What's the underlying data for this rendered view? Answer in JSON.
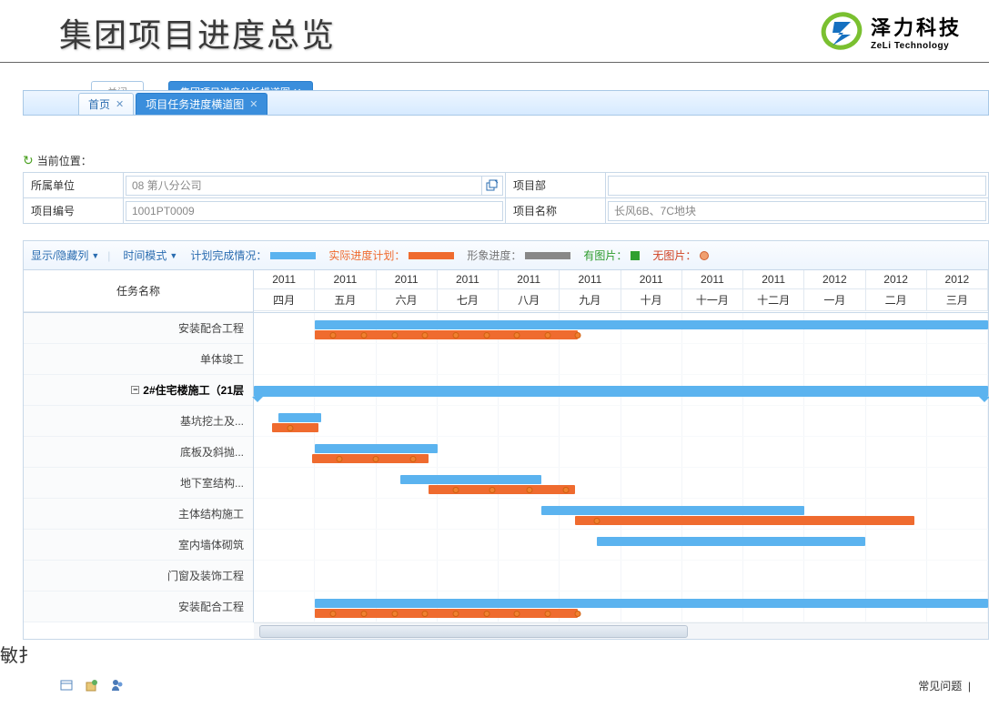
{
  "header": {
    "title": "集团项目进度总览",
    "logo_cn": "泽力科技",
    "logo_en": "ZeLi Technology"
  },
  "bg_tabs": {
    "t1": "关闭",
    "t2": "集团项目进度分析横道图"
  },
  "tabs": [
    {
      "label": "首页",
      "active": false
    },
    {
      "label": "项目任务进度横道图",
      "active": true
    }
  ],
  "breadcrumb": {
    "label": "当前位置："
  },
  "form": {
    "unit_label": "所属单位",
    "unit_value": "08 第八分公司",
    "dept_label": "项目部",
    "dept_value": "",
    "code_label": "项目编号",
    "code_value": "1001PT0009",
    "name_label": "项目名称",
    "name_value": "长风6B、7C地块"
  },
  "toolbar": {
    "show_hide": "显示/隐藏列",
    "time_mode": "时间模式",
    "legend_plan": "计划完成情况：",
    "legend_actual": "实际进度计划：",
    "legend_image": "形象进度：",
    "legend_has_pic": "有图片：",
    "legend_no_pic": "无图片："
  },
  "gantt": {
    "task_header": "任务名称",
    "years": [
      "2011",
      "2011",
      "2011",
      "2011",
      "2011",
      "2011",
      "2011",
      "2011",
      "2011",
      "2012",
      "2012",
      "2012"
    ],
    "months": [
      "四月",
      "五月",
      "六月",
      "七月",
      "八月",
      "九月",
      "十月",
      "十一月",
      "十二月",
      "一月",
      "二月",
      "三月"
    ],
    "tasks": [
      {
        "name": "安装配合工程"
      },
      {
        "name": "单体竣工"
      },
      {
        "name": "2#住宅楼施工（21层",
        "bold": true,
        "expand": true
      },
      {
        "name": "基坑挖土及..."
      },
      {
        "name": "底板及斜抛..."
      },
      {
        "name": "地下室结构..."
      },
      {
        "name": "主体结构施工"
      },
      {
        "name": "室内墙体砌筑"
      },
      {
        "name": "门窗及装饰工程"
      },
      {
        "name": "安装配合工程"
      }
    ]
  },
  "chart_data": {
    "type": "gantt",
    "x_axis": {
      "start": "2011-04",
      "end": "2012-03",
      "columns": 12
    },
    "legend": {
      "plan": "#5bb3ef",
      "actual": "#ef6b2f",
      "image_progress": "#888888",
      "has_image": "green-square",
      "no_image": "orange-circle"
    },
    "rows": [
      {
        "task": "安装配合工程",
        "plan": [
          1.0,
          12.0
        ],
        "actual": [
          1.0,
          5.3
        ],
        "dots": [
          1.3,
          1.8,
          2.3,
          2.8,
          3.3,
          3.8,
          4.3,
          4.8,
          5.3
        ]
      },
      {
        "task": "单体竣工",
        "plan": null,
        "actual": null
      },
      {
        "task": "2#住宅楼施工（21层",
        "summary": [
          0.0,
          12.0
        ]
      },
      {
        "task": "基坑挖土及...",
        "plan": [
          0.4,
          1.1
        ],
        "actual": [
          0.3,
          1.05
        ],
        "dots": [
          0.6
        ]
      },
      {
        "task": "底板及斜抛...",
        "plan": [
          1.0,
          3.0
        ],
        "actual": [
          0.95,
          2.85
        ],
        "dots": [
          1.4,
          2.0,
          2.6
        ]
      },
      {
        "task": "地下室结构...",
        "plan": [
          2.4,
          4.7
        ],
        "actual": [
          2.85,
          5.25
        ],
        "dots": [
          3.3,
          3.9,
          4.5,
          5.1
        ]
      },
      {
        "task": "主体结构施工",
        "plan": [
          4.7,
          9.0
        ],
        "actual": [
          5.25,
          10.8
        ],
        "dots": [
          5.6
        ]
      },
      {
        "task": "室内墙体砌筑",
        "plan": [
          5.6,
          10.0
        ],
        "actual": null
      },
      {
        "task": "门窗及装饰工程",
        "plan": null,
        "actual": null
      },
      {
        "task": "安装配合工程",
        "plan": [
          1.0,
          12.0
        ],
        "actual": [
          1.0,
          5.3
        ],
        "dots": [
          1.3,
          1.8,
          2.3,
          2.8,
          3.3,
          3.8,
          4.3,
          4.8,
          5.3
        ]
      }
    ],
    "scroll_thumb": {
      "left_col": 0.1,
      "width_cols": 7.0
    }
  },
  "footer": {
    "truncated": "敏扌",
    "faq": "常见问题"
  }
}
